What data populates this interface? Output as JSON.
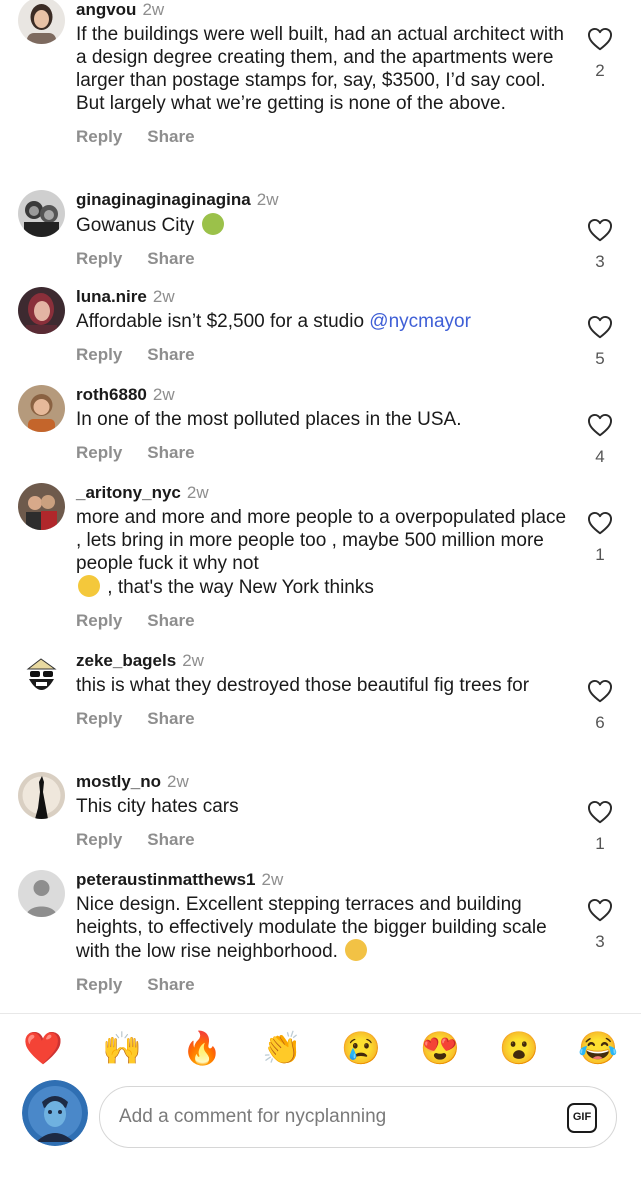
{
  "comments": [
    {
      "username": "angvou",
      "time": "2w",
      "text_parts": [
        "If the buildings were well built, had an actual architect with a design degree creating them, and the apartments were larger than postage stamps for, say, $3500, I’d say cool. But largely what we’re getting is none of the above."
      ],
      "reply_label": "Reply",
      "share_label": "Share",
      "likes": "2",
      "avatar_icon": "woman-portrait-avatar"
    },
    {
      "username": "ginaginaginaginagina",
      "time": "2w",
      "text_parts": [
        "Gowanus City"
      ],
      "text_emoji": "nauseated-face-emoji",
      "reply_label": "Reply",
      "share_label": "Share",
      "likes": "3",
      "avatar_icon": "black-and-white-photo-avatar"
    },
    {
      "username": "luna.nire",
      "time": "2w",
      "text_parts": [
        "Affordable isn’t $2,500 for a studio "
      ],
      "mention": "@nycmayor",
      "reply_label": "Reply",
      "share_label": "Share",
      "likes": "5",
      "avatar_icon": "woman-red-hair-avatar"
    },
    {
      "username": "roth6880",
      "time": "2w",
      "text_parts": [
        "In one of the most polluted places in the USA."
      ],
      "reply_label": "Reply",
      "share_label": "Share",
      "likes": "4",
      "avatar_icon": "child-portrait-avatar"
    },
    {
      "username": "_aritony_nyc",
      "time": "2w",
      "text_parts": [
        "more and more and more people to a overpopulated place , lets bring in more people too , maybe 500 million more people fuck it why not",
        " , that's the way New York thinks"
      ],
      "text_emoji": "tears-of-joy-emoji",
      "reply_label": "Reply",
      "share_label": "Share",
      "likes": "1",
      "avatar_icon": "couple-photo-avatar"
    },
    {
      "username": "zeke_bagels",
      "time": "2w",
      "text_parts": [
        "this is what they destroyed those beautiful fig trees for"
      ],
      "reply_label": "Reply",
      "share_label": "Share",
      "likes": "6",
      "avatar_icon": "bearded-sunglasses-cartoon-avatar"
    },
    {
      "username": "mostly_no",
      "time": "2w",
      "text_parts": [
        "This city hates cars"
      ],
      "reply_label": "Reply",
      "share_label": "Share",
      "likes": "1",
      "avatar_icon": "statue-of-liberty-silhouette-avatar"
    },
    {
      "username": "peteraustinmatthews1",
      "time": "2w",
      "text_parts": [
        "Nice design. Excellent stepping terraces and building heights, to effectively modulate the bigger building scale with the low rise neighborhood."
      ],
      "text_emoji": "clapping-hands-emoji",
      "reply_label": "Reply",
      "share_label": "Share",
      "likes": "3",
      "avatar_icon": "default-user-avatar"
    }
  ],
  "reactions": [
    {
      "emoji": "❤️",
      "name": "red-heart-emoji"
    },
    {
      "emoji": "🙌",
      "name": "raising-hands-emoji"
    },
    {
      "emoji": "🔥",
      "name": "fire-emoji"
    },
    {
      "emoji": "👏",
      "name": "clapping-hands-emoji"
    },
    {
      "emoji": "😢",
      "name": "crying-face-emoji"
    },
    {
      "emoji": "😍",
      "name": "heart-eyes-emoji"
    },
    {
      "emoji": "😮",
      "name": "surprised-face-emoji"
    },
    {
      "emoji": "😂",
      "name": "tears-of-joy-emoji"
    }
  ],
  "composer": {
    "placeholder": "Add a comment for nycplanning",
    "gif_label": "GIF",
    "avatar_icon": "cartoon-man-avatar"
  },
  "colors": {
    "mention": "#3f5fd6",
    "secondary_text": "#8e8e8e",
    "border": "#d6d6d6"
  }
}
